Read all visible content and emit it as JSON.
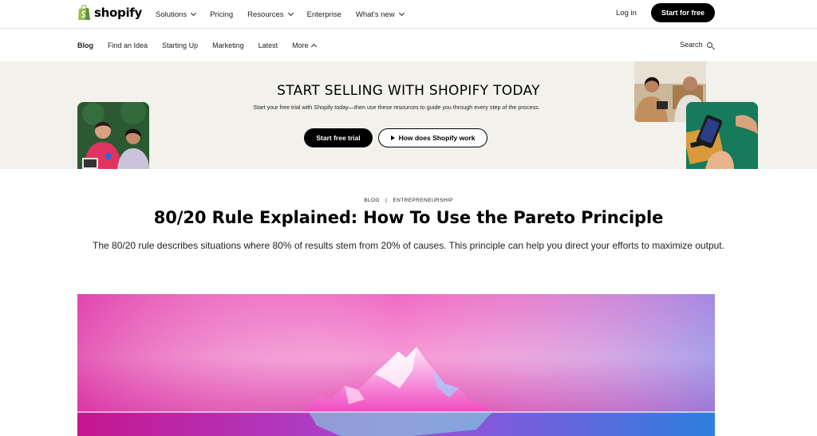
{
  "header": {
    "brand": "shopify",
    "nav": [
      {
        "label": "Solutions",
        "has_dropdown": true
      },
      {
        "label": "Pricing",
        "has_dropdown": false
      },
      {
        "label": "Resources",
        "has_dropdown": true
      },
      {
        "label": "Enterprise",
        "has_dropdown": false
      },
      {
        "label": "What's new",
        "has_dropdown": true
      }
    ],
    "login": "Log in",
    "cta": "Start for free"
  },
  "subnav": {
    "items": [
      {
        "label": "Blog",
        "active": true
      },
      {
        "label": "Find an Idea"
      },
      {
        "label": "Starting Up"
      },
      {
        "label": "Marketing"
      },
      {
        "label": "Latest"
      },
      {
        "label": "More"
      }
    ],
    "search": "Search"
  },
  "banner": {
    "title": "START SELLING WITH SHOPIFY TODAY",
    "subtitle": "Start your free trial with Shopify today—then use these resources to guide you through every step of the process.",
    "primary_button": "Start free trial",
    "secondary_button": "How does Shopify work"
  },
  "article": {
    "category": "BLOG",
    "tag": "ENTREPRENEURSHIP",
    "title": "80/20 Rule Explained: How To Use the Pareto Principle",
    "description": "The 80/20 rule describes situations where 80% of results stem from 20% of causes. This principle can help you direct your efforts to maximize output."
  },
  "colors": {
    "brand_green": "#95bf47",
    "black": "#000000",
    "banner_bg": "#f2f1ec",
    "hero_pink": "#e23ba0",
    "hero_blue": "#2d7fe0"
  },
  "icons": {
    "logo": "shopify-bag-icon",
    "search": "search-icon",
    "play": "play-icon",
    "dropdown": "chevron-down-icon"
  }
}
